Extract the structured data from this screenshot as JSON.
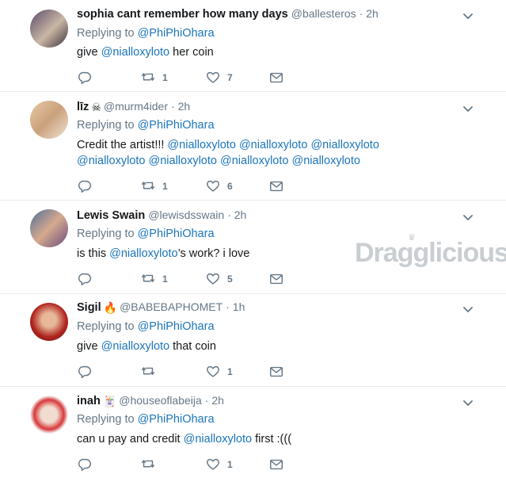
{
  "watermark": "Dragglicious",
  "icons": {
    "reply": "reply-icon",
    "retweet": "retweet-icon",
    "like": "heart-icon",
    "dm": "envelope-icon",
    "menu": "chevron-down-icon"
  },
  "colors": {
    "link": "#1b75bb",
    "muted": "#657786",
    "divider": "#e6ecf0"
  },
  "tweets": [
    {
      "name": "sophia cant remember how many days",
      "handle": "@ballesteros",
      "time": "· 2h",
      "replying_label": "Replying to",
      "replying_to": "@PhiPhiOhara",
      "body_segments": [
        {
          "text": "give ",
          "link": false
        },
        {
          "text": "@nialloxyloto",
          "link": true
        },
        {
          "text": " her coin",
          "link": false
        }
      ],
      "retweets": "1",
      "likes": "7"
    },
    {
      "name": "līz",
      "emoji": "☠",
      "handle": "@murm4ider",
      "time": "· 2h",
      "replying_label": "Replying to",
      "replying_to": "@PhiPhiOhara",
      "body_segments": [
        {
          "text": "Credit the artist!!! ",
          "link": false
        },
        {
          "text": "@nialloxyloto",
          "link": true
        },
        {
          "text": " ",
          "link": false
        },
        {
          "text": "@nialloxyloto",
          "link": true
        },
        {
          "text": " ",
          "link": false
        },
        {
          "text": "@nialloxyloto",
          "link": true
        },
        {
          "text": " ",
          "link": false
        },
        {
          "text": "@nialloxyloto",
          "link": true
        },
        {
          "text": " ",
          "link": false
        },
        {
          "text": "@nialloxyloto",
          "link": true
        },
        {
          "text": " ",
          "link": false
        },
        {
          "text": "@nialloxyloto",
          "link": true
        },
        {
          "text": " ",
          "link": false
        },
        {
          "text": "@nialloxyloto",
          "link": true
        }
      ],
      "retweets": "1",
      "likes": "6"
    },
    {
      "name": "Lewis Swain",
      "handle": "@lewisdsswain",
      "time": "· 2h",
      "replying_label": "Replying to",
      "replying_to": "@PhiPhiOhara",
      "body_segments": [
        {
          "text": "is this ",
          "link": false
        },
        {
          "text": "@nialloxyloto",
          "link": true
        },
        {
          "text": "’s work? i love",
          "link": false
        }
      ],
      "retweets": "1",
      "likes": "5"
    },
    {
      "name": "Sigil",
      "emoji": "🔥",
      "handle": "@BABEBAPHOMET",
      "time": "· 1h",
      "replying_label": "Replying to",
      "replying_to": "@PhiPhiOhara",
      "body_segments": [
        {
          "text": "give ",
          "link": false
        },
        {
          "text": "@nialloxyloto",
          "link": true
        },
        {
          "text": " that coin",
          "link": false
        }
      ],
      "retweets": "",
      "likes": "1"
    },
    {
      "name": "inah",
      "emoji": "🃏",
      "handle": "@houseoflabeija",
      "time": "· 2h",
      "replying_label": "Replying to",
      "replying_to": "@PhiPhiOhara",
      "body_segments": [
        {
          "text": "can u pay and credit ",
          "link": false
        },
        {
          "text": "@nialloxyloto",
          "link": true
        },
        {
          "text": " first :(((",
          "link": false
        }
      ],
      "retweets": "",
      "likes": "1"
    }
  ]
}
